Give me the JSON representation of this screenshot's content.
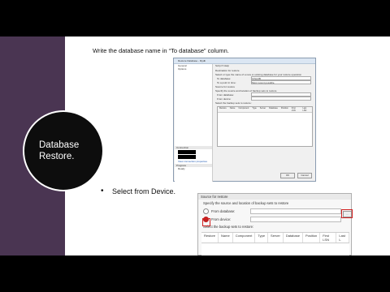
{
  "sidebar": {
    "title": "Database\nRestore."
  },
  "instruction": "Write the database name in “To database” column.",
  "bullet": "Select from Device.",
  "dialog": {
    "title": "Restore Database - Mydb",
    "pages": [
      "General",
      "Options"
    ],
    "toolbar": "Script ▾  Help",
    "destination_header": "Destination for restore",
    "destination_desc": "Select or type the name of a new or existing database for your restore operation",
    "to_database_label": "To database:",
    "to_database_value": "ICSLDB",
    "to_point_label": "To a point in time:",
    "to_point_value": "Most recent possible",
    "source_header": "Source for restore",
    "source_desc": "Specify the source and location of backup sets to restore",
    "from_database_label": "From database:",
    "from_device_label": "From device:",
    "select_sets": "Select the backup sets to restore:",
    "columns": [
      "Restore",
      "Name",
      "Component",
      "Type",
      "Server",
      "Database",
      "Position",
      "First LSN",
      "Last LSN"
    ],
    "connection_header": "Connection",
    "view_props": "View connection properties",
    "progress_header": "Progress",
    "progress_status": "Ready",
    "ok": "OK",
    "cancel": "Cancel"
  },
  "zoom": {
    "section": "Source for restore",
    "spec": "Specify the source and location of backup sets to restore",
    "from_database": "From database:",
    "from_device": "From device:",
    "browse": "...",
    "select_sets": "Select the backup sets to restore:",
    "columns": [
      "Restore",
      "Name",
      "Component",
      "Type",
      "Server",
      "Database",
      "Position",
      "First LSN",
      "Last L"
    ]
  }
}
